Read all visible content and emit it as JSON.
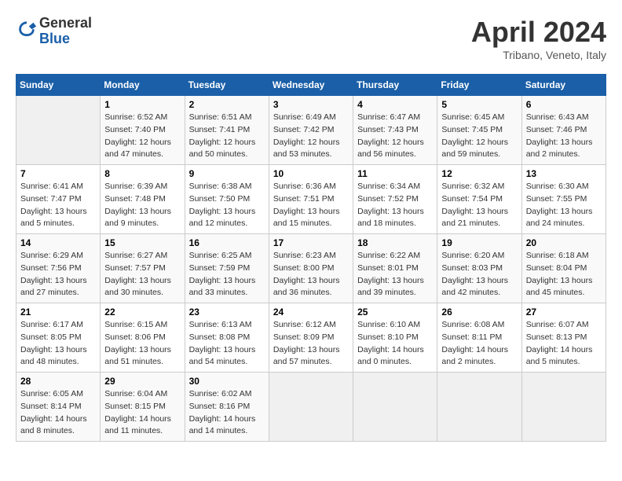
{
  "header": {
    "logo_general": "General",
    "logo_blue": "Blue",
    "title": "April 2024",
    "location": "Tribano, Veneto, Italy"
  },
  "calendar": {
    "days_of_week": [
      "Sunday",
      "Monday",
      "Tuesday",
      "Wednesday",
      "Thursday",
      "Friday",
      "Saturday"
    ],
    "weeks": [
      [
        {
          "day": "",
          "info": ""
        },
        {
          "day": "1",
          "info": "Sunrise: 6:52 AM\nSunset: 7:40 PM\nDaylight: 12 hours\nand 47 minutes."
        },
        {
          "day": "2",
          "info": "Sunrise: 6:51 AM\nSunset: 7:41 PM\nDaylight: 12 hours\nand 50 minutes."
        },
        {
          "day": "3",
          "info": "Sunrise: 6:49 AM\nSunset: 7:42 PM\nDaylight: 12 hours\nand 53 minutes."
        },
        {
          "day": "4",
          "info": "Sunrise: 6:47 AM\nSunset: 7:43 PM\nDaylight: 12 hours\nand 56 minutes."
        },
        {
          "day": "5",
          "info": "Sunrise: 6:45 AM\nSunset: 7:45 PM\nDaylight: 12 hours\nand 59 minutes."
        },
        {
          "day": "6",
          "info": "Sunrise: 6:43 AM\nSunset: 7:46 PM\nDaylight: 13 hours\nand 2 minutes."
        }
      ],
      [
        {
          "day": "7",
          "info": "Sunrise: 6:41 AM\nSunset: 7:47 PM\nDaylight: 13 hours\nand 5 minutes."
        },
        {
          "day": "8",
          "info": "Sunrise: 6:39 AM\nSunset: 7:48 PM\nDaylight: 13 hours\nand 9 minutes."
        },
        {
          "day": "9",
          "info": "Sunrise: 6:38 AM\nSunset: 7:50 PM\nDaylight: 13 hours\nand 12 minutes."
        },
        {
          "day": "10",
          "info": "Sunrise: 6:36 AM\nSunset: 7:51 PM\nDaylight: 13 hours\nand 15 minutes."
        },
        {
          "day": "11",
          "info": "Sunrise: 6:34 AM\nSunset: 7:52 PM\nDaylight: 13 hours\nand 18 minutes."
        },
        {
          "day": "12",
          "info": "Sunrise: 6:32 AM\nSunset: 7:54 PM\nDaylight: 13 hours\nand 21 minutes."
        },
        {
          "day": "13",
          "info": "Sunrise: 6:30 AM\nSunset: 7:55 PM\nDaylight: 13 hours\nand 24 minutes."
        }
      ],
      [
        {
          "day": "14",
          "info": "Sunrise: 6:29 AM\nSunset: 7:56 PM\nDaylight: 13 hours\nand 27 minutes."
        },
        {
          "day": "15",
          "info": "Sunrise: 6:27 AM\nSunset: 7:57 PM\nDaylight: 13 hours\nand 30 minutes."
        },
        {
          "day": "16",
          "info": "Sunrise: 6:25 AM\nSunset: 7:59 PM\nDaylight: 13 hours\nand 33 minutes."
        },
        {
          "day": "17",
          "info": "Sunrise: 6:23 AM\nSunset: 8:00 PM\nDaylight: 13 hours\nand 36 minutes."
        },
        {
          "day": "18",
          "info": "Sunrise: 6:22 AM\nSunset: 8:01 PM\nDaylight: 13 hours\nand 39 minutes."
        },
        {
          "day": "19",
          "info": "Sunrise: 6:20 AM\nSunset: 8:03 PM\nDaylight: 13 hours\nand 42 minutes."
        },
        {
          "day": "20",
          "info": "Sunrise: 6:18 AM\nSunset: 8:04 PM\nDaylight: 13 hours\nand 45 minutes."
        }
      ],
      [
        {
          "day": "21",
          "info": "Sunrise: 6:17 AM\nSunset: 8:05 PM\nDaylight: 13 hours\nand 48 minutes."
        },
        {
          "day": "22",
          "info": "Sunrise: 6:15 AM\nSunset: 8:06 PM\nDaylight: 13 hours\nand 51 minutes."
        },
        {
          "day": "23",
          "info": "Sunrise: 6:13 AM\nSunset: 8:08 PM\nDaylight: 13 hours\nand 54 minutes."
        },
        {
          "day": "24",
          "info": "Sunrise: 6:12 AM\nSunset: 8:09 PM\nDaylight: 13 hours\nand 57 minutes."
        },
        {
          "day": "25",
          "info": "Sunrise: 6:10 AM\nSunset: 8:10 PM\nDaylight: 14 hours\nand 0 minutes."
        },
        {
          "day": "26",
          "info": "Sunrise: 6:08 AM\nSunset: 8:11 PM\nDaylight: 14 hours\nand 2 minutes."
        },
        {
          "day": "27",
          "info": "Sunrise: 6:07 AM\nSunset: 8:13 PM\nDaylight: 14 hours\nand 5 minutes."
        }
      ],
      [
        {
          "day": "28",
          "info": "Sunrise: 6:05 AM\nSunset: 8:14 PM\nDaylight: 14 hours\nand 8 minutes."
        },
        {
          "day": "29",
          "info": "Sunrise: 6:04 AM\nSunset: 8:15 PM\nDaylight: 14 hours\nand 11 minutes."
        },
        {
          "day": "30",
          "info": "Sunrise: 6:02 AM\nSunset: 8:16 PM\nDaylight: 14 hours\nand 14 minutes."
        },
        {
          "day": "",
          "info": ""
        },
        {
          "day": "",
          "info": ""
        },
        {
          "day": "",
          "info": ""
        },
        {
          "day": "",
          "info": ""
        }
      ]
    ]
  }
}
